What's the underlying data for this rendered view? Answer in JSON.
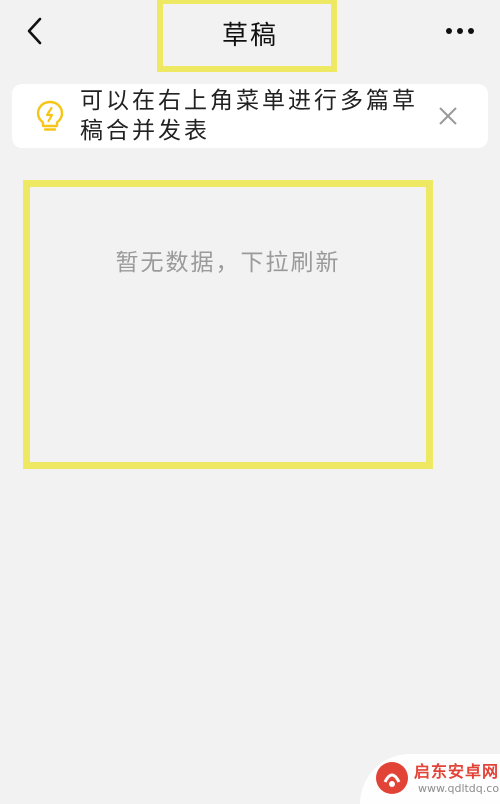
{
  "header": {
    "title": "草稿",
    "back_icon": "chevron-left-icon",
    "more_icon": "more-dots-icon"
  },
  "tip": {
    "icon": "lightning-bulb-icon",
    "text": "可以在右上角菜单进行多篇草稿合并发表",
    "close_icon": "close-icon",
    "accent_color": "#f5c518"
  },
  "empty": {
    "message": "暂无数据，下拉刷新"
  },
  "watermark": {
    "name": "启东安卓网",
    "url": "www.qdltdq.com"
  },
  "colors": {
    "highlight": "#efe862",
    "background": "#f2f2f2"
  }
}
